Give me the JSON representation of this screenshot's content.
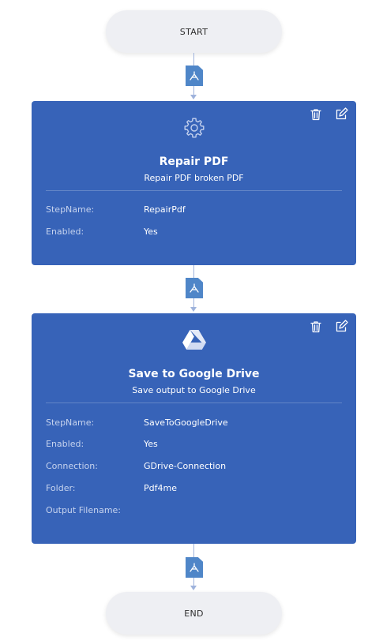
{
  "flow": {
    "start_label": "START",
    "end_label": "END",
    "file_icon": "pdf-file-icon"
  },
  "steps": [
    {
      "icon": "gear-icon",
      "title": "Repair PDF",
      "subtitle": "Repair PDF broken PDF",
      "props": [
        {
          "label": "StepName:",
          "value": "RepairPdf"
        },
        {
          "label": "Enabled:",
          "value": "Yes"
        }
      ]
    },
    {
      "icon": "google-drive-icon",
      "title": "Save to Google Drive",
      "subtitle": "Save output to Google Drive",
      "props": [
        {
          "label": "StepName:",
          "value": "SaveToGoogleDrive"
        },
        {
          "label": "Enabled:",
          "value": "Yes"
        },
        {
          "label": "Connection:",
          "value": "GDrive-Connection"
        },
        {
          "label": "Folder:",
          "value": "Pdf4me"
        },
        {
          "label": "Output Filename:",
          "value": ""
        }
      ]
    }
  ],
  "actions": {
    "delete_icon": "trash-icon",
    "edit_icon": "edit-icon"
  },
  "colors": {
    "card_background": "#3763b8",
    "pill_background": "#eeeff3",
    "file_icon": "#4f86c8",
    "connector": "#9fb3dc"
  }
}
